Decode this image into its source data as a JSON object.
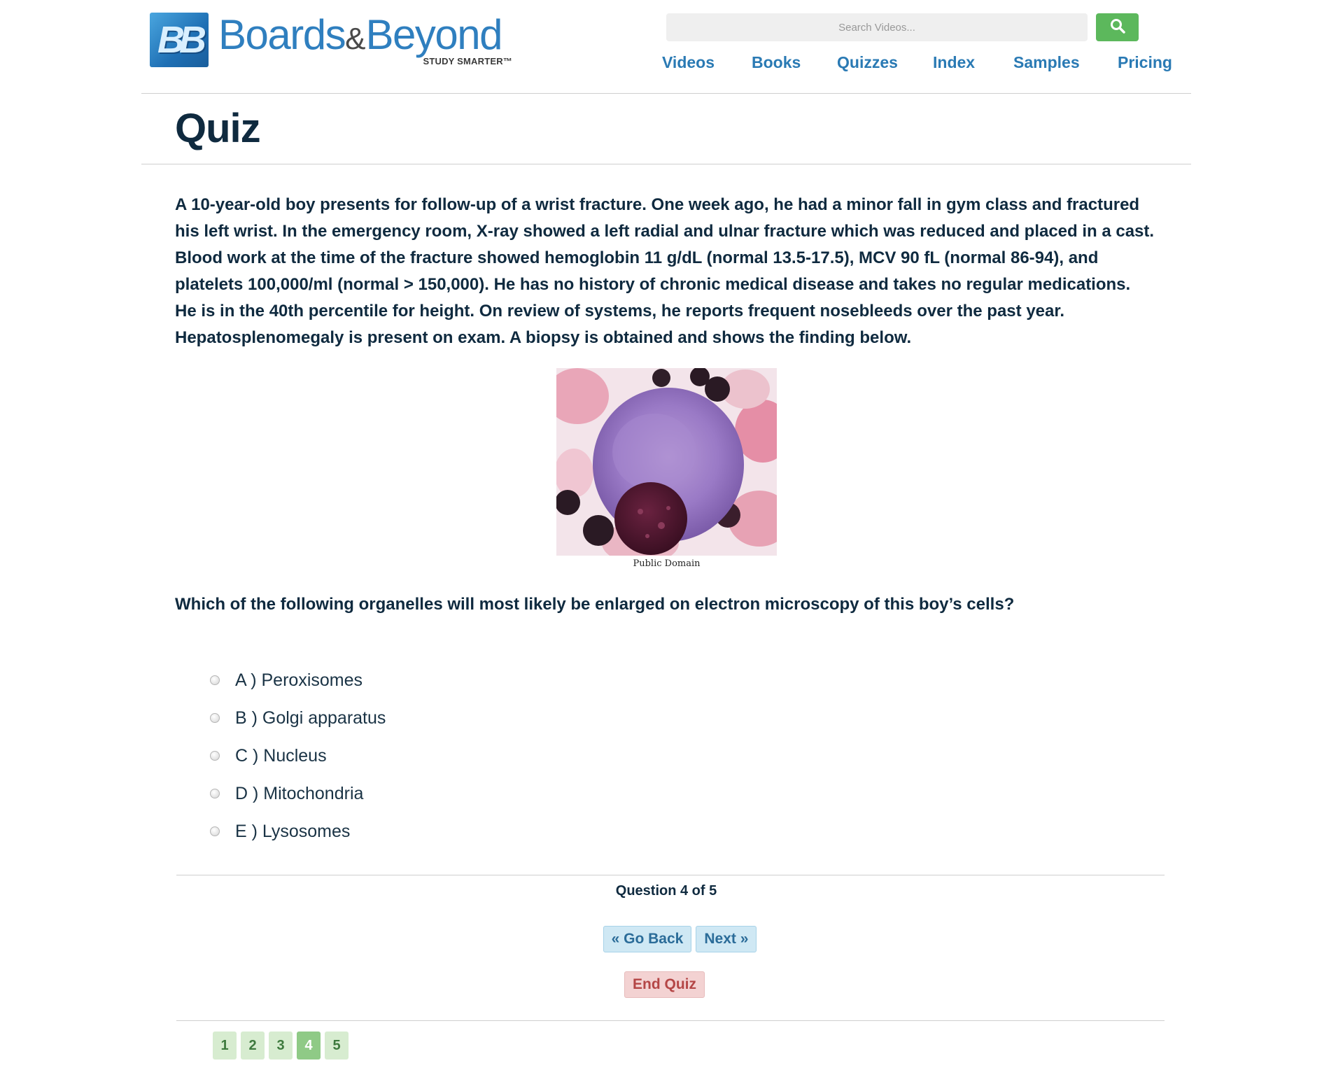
{
  "header": {
    "logo": {
      "name": "Boards&Beyond",
      "mark": "BB",
      "word_left": "Boards",
      "word_amp": "&",
      "word_right": "Beyond",
      "tagline": "STUDY SMARTER™"
    },
    "search": {
      "placeholder": "Search Videos...",
      "icon": "search-icon"
    },
    "nav": [
      "Videos",
      "Books",
      "Quizzes",
      "Index",
      "Samples",
      "Pricing"
    ]
  },
  "page": {
    "title": "Quiz"
  },
  "quiz": {
    "stem": "A 10-year-old boy presents for follow-up of a wrist fracture. One week ago, he had a minor fall in gym class and fractured his left wrist. In the emergency room, X-ray showed a left radial and ulnar fracture which was reduced and placed in a cast. Blood work at the time of the fracture showed hemoglobin 11 g/dL (normal 13.5-17.5), MCV 90 fL (normal 86-94), and platelets 100,000/ml (normal > 150,000). He has no history of chronic medical disease and takes no regular medications. He is in the 40th percentile for height. On review of systems, he reports frequent nosebleeds over the past year. Hepatosplenomegaly is present on exam. A biopsy is obtained and shows the finding below.",
    "image_caption": "Public Domain",
    "question": "Which of the following organelles will most likely be enlarged on electron microscopy of this boy’s cells?",
    "options": [
      "A ) Peroxisomes",
      "B ) Golgi apparatus",
      "C ) Nucleus",
      "D ) Mitochondria",
      "E ) Lysosomes"
    ],
    "progress": "Question 4 of 5",
    "current_question": 4,
    "total_questions": 5,
    "buttons": {
      "back": "« Go Back",
      "next": "Next »",
      "end": "End Quiz"
    },
    "pages": [
      "1",
      "2",
      "3",
      "4",
      "5"
    ]
  },
  "colors": {
    "brand_blue": "#2f7fbf",
    "nav_blue": "#2a7ab4",
    "search_green": "#5cb85c",
    "text_dark": "#0f2a3f",
    "end_red": "#b44646",
    "page_green": "#8fca86"
  }
}
